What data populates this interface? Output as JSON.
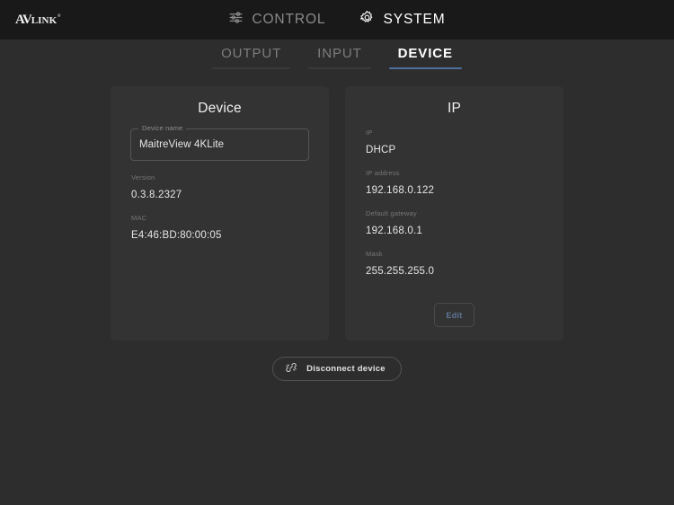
{
  "colors": {
    "page_bg": "#2d2d2d",
    "header_bg": "#191919",
    "card_bg": "#333333",
    "accent_blue": "#4d6f9e",
    "edit_text": "#5f7596",
    "label_gray": "#767676",
    "value_text": "#e6e6e6"
  },
  "header": {
    "logo": {
      "av": "AV",
      "link": "LINK",
      "tm": "®",
      "icon": "avlink-logo"
    },
    "nav": [
      {
        "label": "CONTROL",
        "icon": "sliders-icon",
        "active": false
      },
      {
        "label": "SYSTEM",
        "icon": "gear-icon",
        "active": true
      }
    ]
  },
  "tabs": [
    {
      "label": "OUTPUT",
      "active": false
    },
    {
      "label": "INPUT",
      "active": false
    },
    {
      "label": "DEVICE",
      "active": true
    }
  ],
  "device_card": {
    "title": "Device",
    "name_field": {
      "legend": "Device name",
      "value": "MaitreView 4KLite",
      "placeholder": "Device name"
    },
    "rows": [
      {
        "label": "Version",
        "value": "0.3.8.2327"
      },
      {
        "label": "MAC",
        "value": "E4:46:BD:80:00:05"
      }
    ]
  },
  "ip_card": {
    "title": "IP",
    "rows": [
      {
        "label": "IP",
        "value": "DHCP"
      },
      {
        "label": "IP address",
        "value": "192.168.0.122"
      },
      {
        "label": "Default gateway",
        "value": "192.168.0.1"
      },
      {
        "label": "Mask",
        "value": "255.255.255.0"
      }
    ],
    "edit_label": "Edit"
  },
  "footer": {
    "disconnect_label": "Disconnect device",
    "disconnect_icon": "unlink-icon"
  }
}
